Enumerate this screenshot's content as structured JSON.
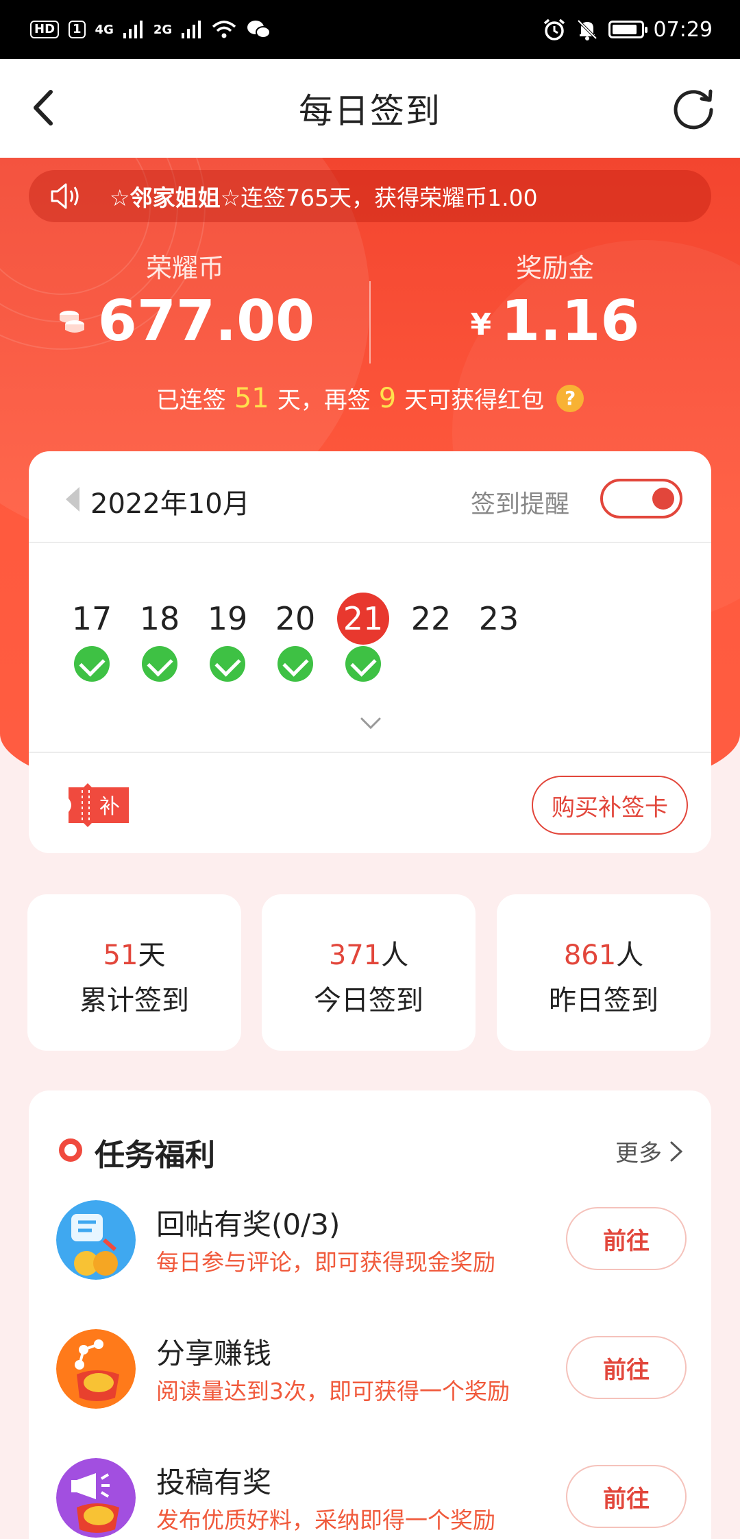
{
  "status_bar": {
    "hd": "HD",
    "sim1": "1",
    "net1": "4G",
    "net2": "2G",
    "time": "07:29"
  },
  "nav": {
    "title": "每日签到"
  },
  "marquee": {
    "name": "☆邻家姐姐☆",
    "text": "连签765天，获得荣耀币1.00"
  },
  "stats_top": {
    "coins_label": "荣耀币",
    "coins_value": "677.00",
    "bonus_label": "奖励金",
    "bonus_currency": "¥",
    "bonus_value": "1.16"
  },
  "streak": {
    "prefix": "已连签",
    "days": "51",
    "mid": "天，再签",
    "remaining": "9",
    "suffix": "天可获得红包",
    "help": "?"
  },
  "calendar": {
    "month": "2022年10月",
    "remind_label": "签到提醒",
    "remind_on": true,
    "days": [
      {
        "num": "17",
        "checked": true,
        "today": false
      },
      {
        "num": "18",
        "checked": true,
        "today": false
      },
      {
        "num": "19",
        "checked": true,
        "today": false
      },
      {
        "num": "20",
        "checked": true,
        "today": false
      },
      {
        "num": "21",
        "checked": true,
        "today": true
      },
      {
        "num": "22",
        "checked": false,
        "today": false
      },
      {
        "num": "23",
        "checked": false,
        "today": false
      }
    ],
    "buy_card_label": "购买补签卡",
    "makeup_icon_text": "补"
  },
  "summary": [
    {
      "value": "51",
      "unit": "天",
      "label": "累计签到"
    },
    {
      "value": "371",
      "unit": "人",
      "label": "今日签到"
    },
    {
      "value": "861",
      "unit": "人",
      "label": "昨日签到"
    }
  ],
  "tasks": {
    "title": "任务福利",
    "more": "更多",
    "items": [
      {
        "name": "回帖有奖(0/3)",
        "desc": "每日参与评论，即可获得现金奖励",
        "button": "前往"
      },
      {
        "name": "分享赚钱",
        "desc": "阅读量达到3次，即可获得一个奖励",
        "button": "前往"
      },
      {
        "name": "投稿有奖",
        "desc": "发布优质好料，采纳即得一个奖励",
        "button": "前往"
      }
    ]
  },
  "colors": {
    "accent": "#e2463b",
    "hero_red": "#f3452f",
    "check_green": "#3ec144",
    "highlight_yellow": "#ffe14d"
  }
}
